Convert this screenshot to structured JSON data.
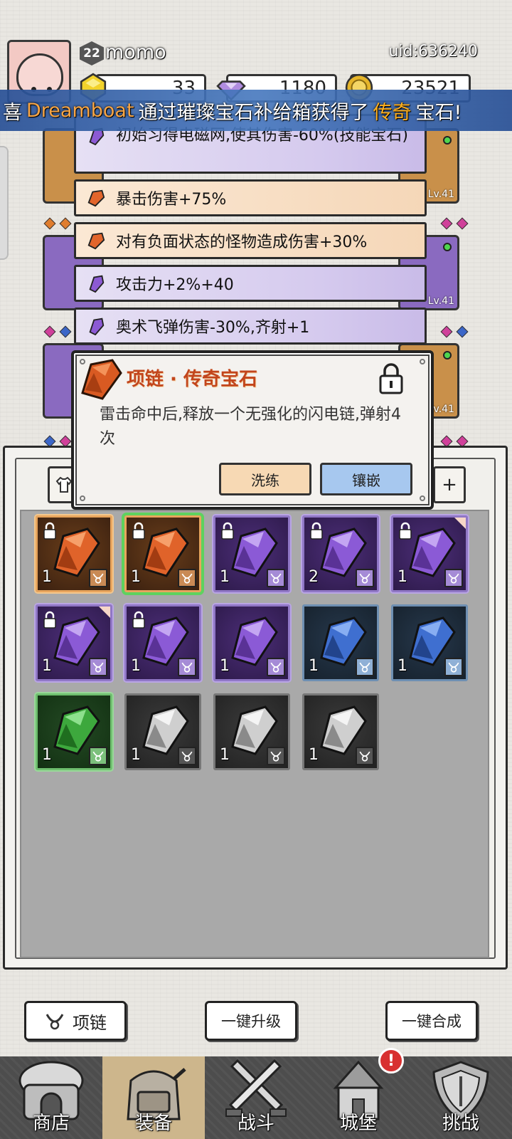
{
  "player": {
    "level": "22",
    "name": "momo",
    "uid": "uid:636240"
  },
  "resources": [
    {
      "icon": "yellow-gem-icon",
      "value": "33"
    },
    {
      "icon": "purple-diamond-icon",
      "value": "1180"
    },
    {
      "icon": "gold-coin-icon",
      "value": "23521"
    }
  ],
  "banner": {
    "prefix": "喜",
    "player": "Dreamboat",
    "middle": "通过璀璨宝石补给箱获得了",
    "rarity": "传奇",
    "suffix": "宝石!"
  },
  "equipment_levels": [
    "Lv.41",
    "Lv.41",
    "Lv.41"
  ],
  "affixes": [
    {
      "color": "purple",
      "text": "初始习得电磁网,使其伤害-60%(技能宝石)"
    },
    {
      "color": "orange",
      "text": "暴击伤害+75%"
    },
    {
      "color": "orange",
      "text": "对有负面状态的怪物造成伤害+30%"
    },
    {
      "color": "purple",
      "text": "攻击力+2%+40"
    },
    {
      "color": "purple",
      "text": "奥术飞弹伤害-30%,齐射+1"
    }
  ],
  "popup": {
    "title": "项链 · 传奇宝石",
    "description": "雷击命中后,释放一个无强化的闪电链,弹射4次",
    "refine_label": "洗练",
    "inlay_label": "镶嵌",
    "locked": true
  },
  "inventory": [
    {
      "rarity": "orange",
      "count": "1",
      "locked": true,
      "corner": false,
      "selected": false
    },
    {
      "rarity": "orange",
      "count": "1",
      "locked": true,
      "corner": false,
      "selected": true
    },
    {
      "rarity": "purple",
      "count": "1",
      "locked": true,
      "corner": false,
      "selected": false
    },
    {
      "rarity": "purple",
      "count": "2",
      "locked": true,
      "corner": false,
      "selected": false
    },
    {
      "rarity": "purple",
      "count": "1",
      "locked": true,
      "corner": true,
      "selected": false
    },
    {
      "rarity": "purple",
      "count": "1",
      "locked": true,
      "corner": true,
      "selected": false
    },
    {
      "rarity": "purple",
      "count": "1",
      "locked": true,
      "corner": false,
      "selected": false
    },
    {
      "rarity": "purple",
      "count": "1",
      "locked": false,
      "corner": false,
      "selected": false
    },
    {
      "rarity": "blue",
      "count": "1",
      "locked": false,
      "corner": false,
      "selected": false
    },
    {
      "rarity": "blue",
      "count": "1",
      "locked": false,
      "corner": false,
      "selected": false
    },
    {
      "rarity": "green",
      "count": "1",
      "locked": false,
      "corner": false,
      "selected": false
    },
    {
      "rarity": "gray",
      "count": "1",
      "locked": false,
      "corner": false,
      "selected": false
    },
    {
      "rarity": "gray",
      "count": "1",
      "locked": false,
      "corner": false,
      "selected": false
    },
    {
      "rarity": "gray",
      "count": "1",
      "locked": false,
      "corner": false,
      "selected": false
    }
  ],
  "actions": {
    "filter_label": "项链",
    "upgrade_all_label": "一键升级",
    "merge_all_label": "一键合成"
  },
  "nav": [
    {
      "label": "商店",
      "icon": "shop-icon",
      "active": false
    },
    {
      "label": "装备",
      "icon": "backpack-icon",
      "active": true
    },
    {
      "label": "战斗",
      "icon": "crossed-swords-icon",
      "active": false
    },
    {
      "label": "城堡",
      "icon": "castle-icon",
      "active": false,
      "alert": "!"
    },
    {
      "label": "挑战",
      "icon": "shield-icon",
      "active": false
    }
  ],
  "colors": {
    "legendary": "#d8642c",
    "epic": "#8a62c8",
    "rare": "#3f6fc2",
    "uncommon": "#3fa13f",
    "common": "#cfcfcf",
    "banner": "#3a6bb0"
  }
}
